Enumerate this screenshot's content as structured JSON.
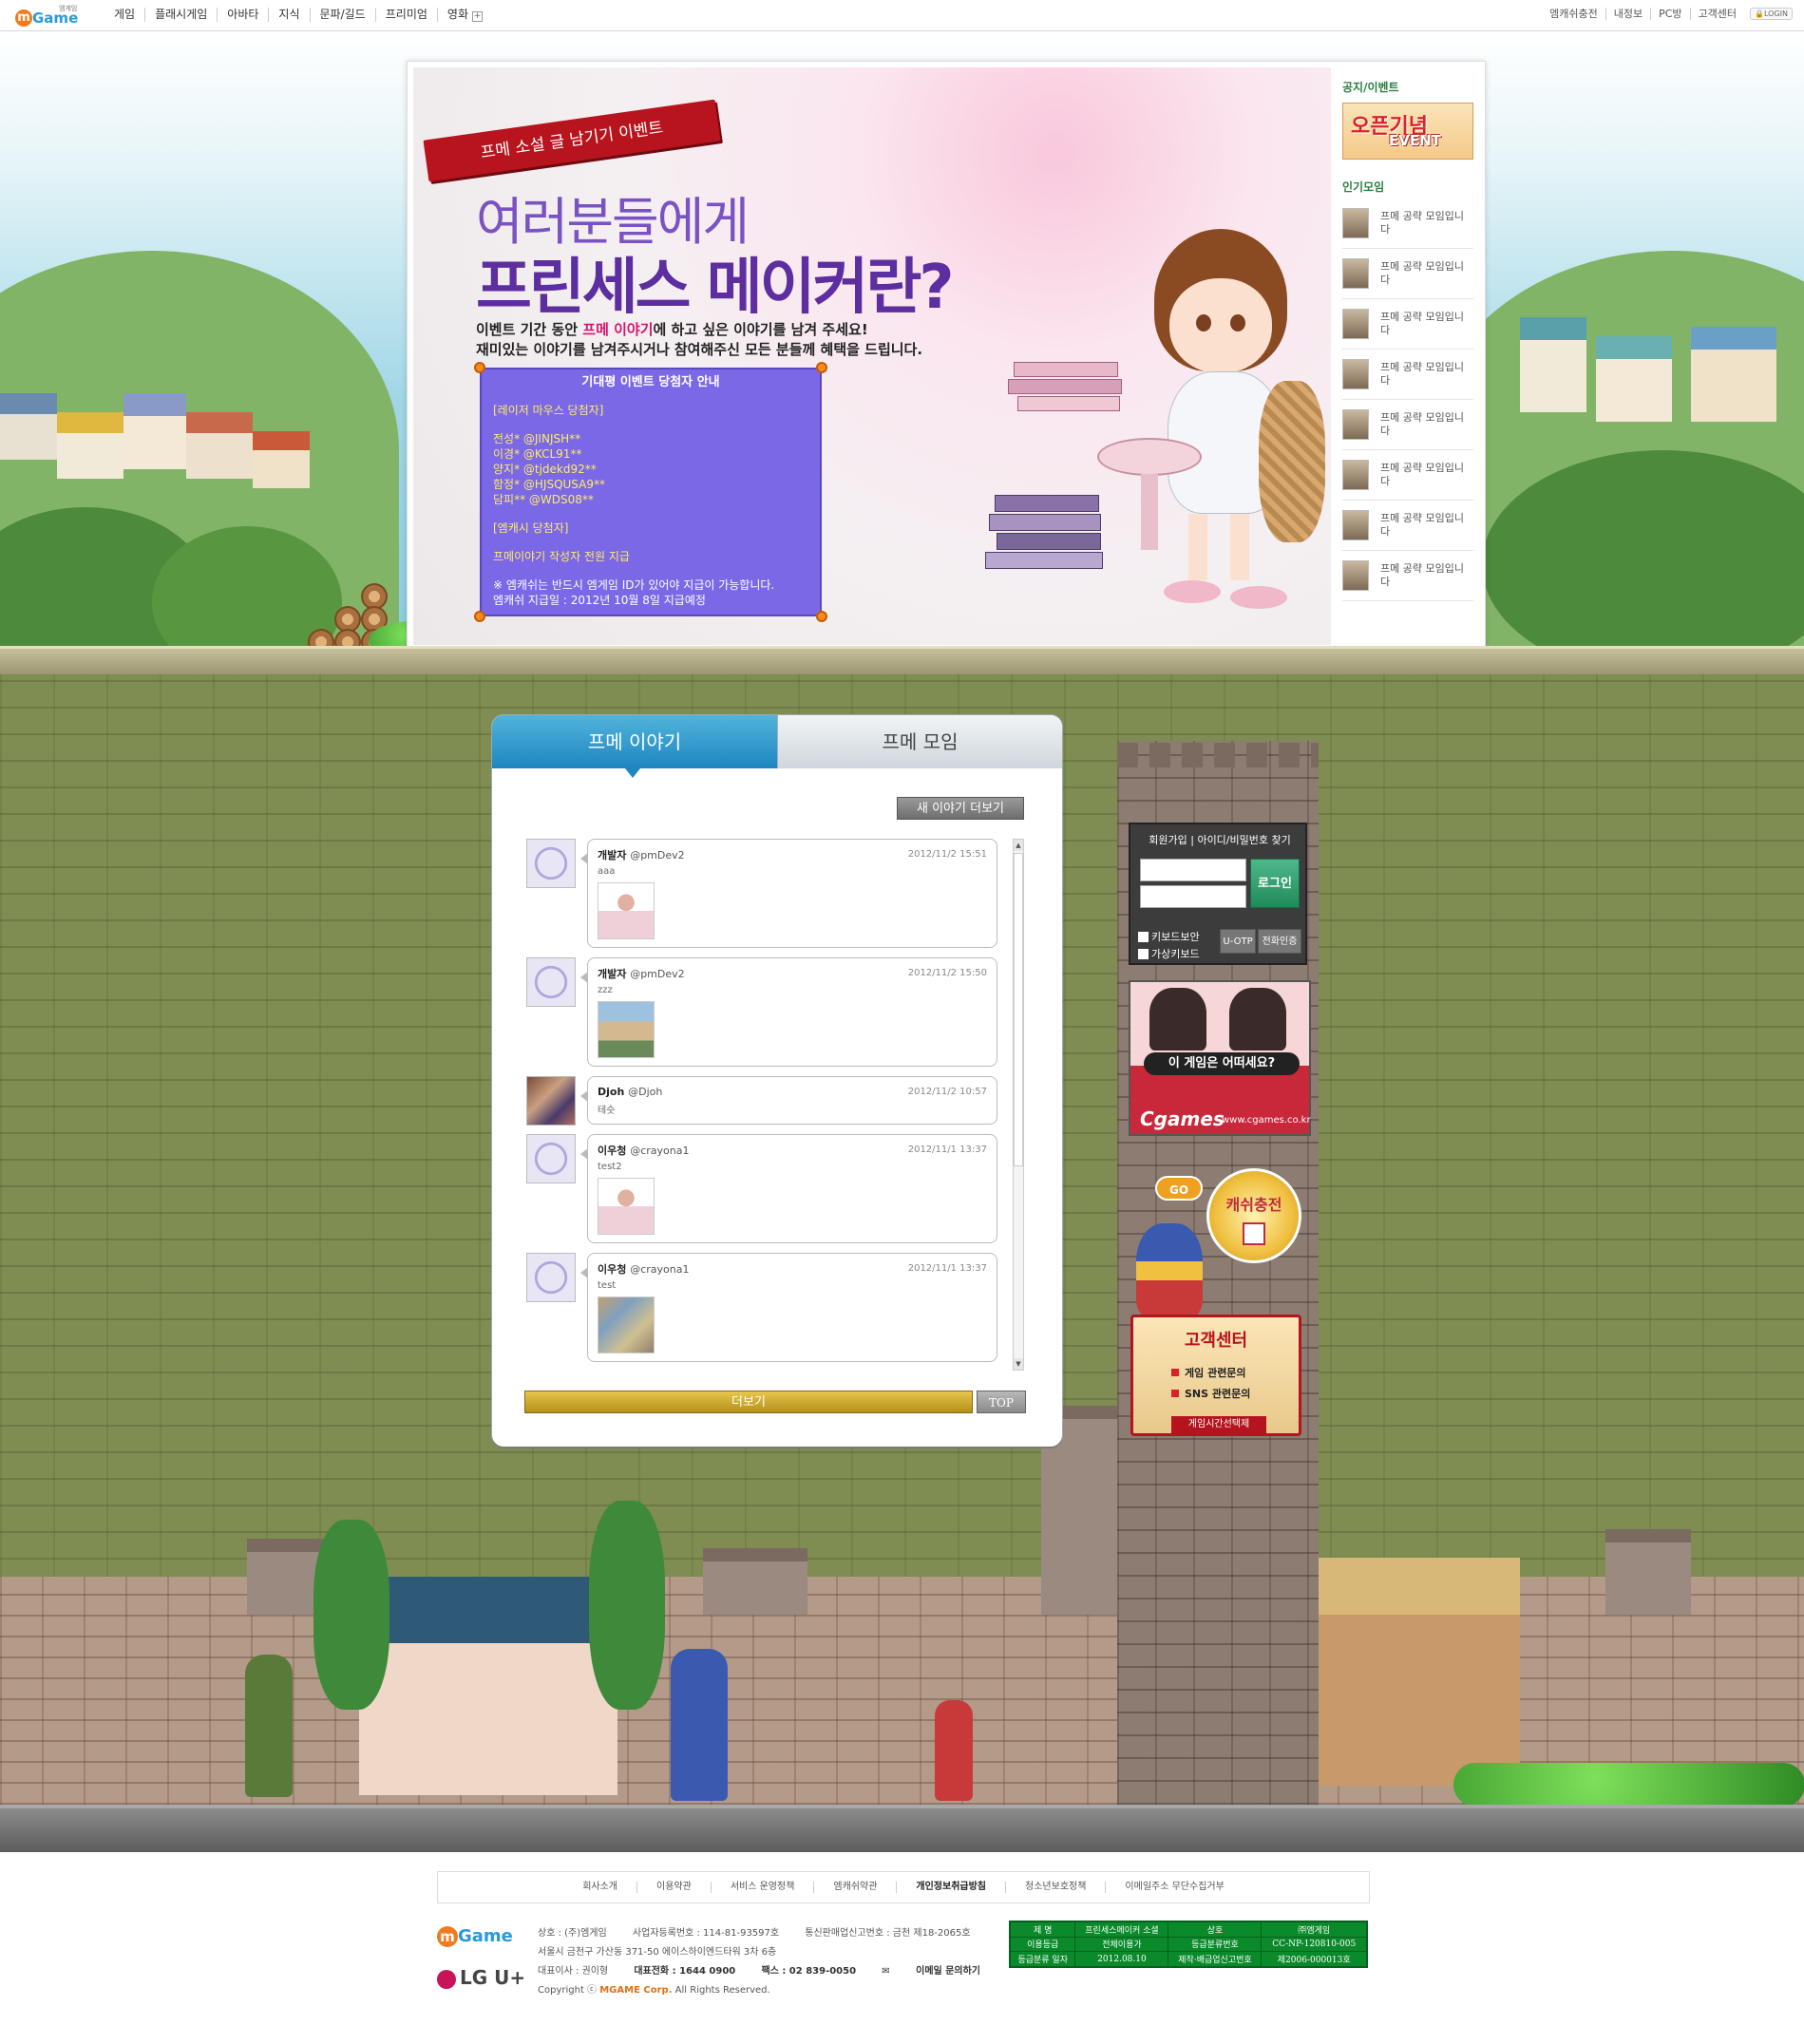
{
  "topnav": {
    "logo": {
      "m": "m",
      "rest": "Game",
      "sub": "엠게임"
    },
    "menu": [
      "게임",
      "플래시게임",
      "아바타",
      "지식",
      "문파/길드",
      "프리미엄",
      "영화"
    ],
    "menu_more": "+",
    "utils": [
      "엠캐쉬충전",
      "내정보",
      "PC방",
      "고객센터"
    ],
    "login_badge": "LOGIN"
  },
  "event": {
    "ribbon": "프메 소설 글 남기기 이벤트",
    "line1": "여러분들에게",
    "line2": "프린세스 메이커란?",
    "desc1_a": "이벤트 기간 동안 ",
    "desc1_hl": "프메 이야기",
    "desc1_b": "에 하고 싶은 이야기를 남겨 주세요!",
    "desc2": "재미있는 이야기를 남겨주시거나 참여해주신 모든 분들께 혜택을 드립니다.",
    "winners": {
      "title": "기대평 이벤트 당첨자 안내",
      "mouse_head": "[레이저 마우스 당첨자]",
      "mouse": [
        "전성* @JINJSH**",
        "이경* @KCL91**",
        "양지* @tjdekd92**",
        "함정* @HJSQUSA9**",
        "담피** @WDS08**"
      ],
      "mcash_head": "[엠캐시 당첨자]",
      "mcash": "프메이야기 작성자 전원 지급",
      "note1": "※ 엠캐쉬는 반드시 엠게임 ID가 있어야 지급이 가능합니다.",
      "note2": "엠캐쉬 지급일 : 2012년 10월 8일 지급예정"
    }
  },
  "side": {
    "notice_title": "공지/이벤트",
    "notice_img": {
      "t1": "오픈기념",
      "t2": "EVENT"
    },
    "groups_title": "인기모임",
    "groups": [
      "프메 공략 모임입니다",
      "프메 공략 모임입니다",
      "프메 공략 모임입니다",
      "프메 공략 모임입니다",
      "프메 공략 모임입니다",
      "프메 공략 모임입니다",
      "프메 공략 모임입니다",
      "프메 공략 모임입니다"
    ]
  },
  "board": {
    "tab_story": "프메 이야기",
    "tab_group": "프메 모임",
    "new_more": "새 이야기 더보기",
    "posts": [
      {
        "name": "개발자",
        "handle": "@pmDev2",
        "time": "2012/11/2 15:51",
        "text": "aaa",
        "img": "girl"
      },
      {
        "name": "개발자",
        "handle": "@pmDev2",
        "time": "2012/11/2 15:50",
        "text": "zzz",
        "img": "scene"
      },
      {
        "name": "Djoh",
        "handle": "@Djoh",
        "time": "2012/11/2 10:57",
        "text": "테슷",
        "img": ""
      },
      {
        "name": "이우청",
        "handle": "@crayona1",
        "time": "2012/11/1 13:37",
        "text": "test2",
        "img": "girl"
      },
      {
        "name": "이우청",
        "handle": "@crayona1",
        "time": "2012/11/1 13:37",
        "text": "test",
        "img": "scene2"
      }
    ],
    "more": "더보기",
    "top": "TOP"
  },
  "login": {
    "links": "회원가입 | 아이디/비밀번호 찾기",
    "button": "로그인",
    "chk1": "키보드보안",
    "chk2": "가상키보드",
    "otp": "U-OTP",
    "phone": "전화인증"
  },
  "cgames": {
    "question": "이 게임은 어떠세요?",
    "logo": "Cgames",
    "url": "www.cgames.co.kr"
  },
  "cash": {
    "go": "GO",
    "label": "캐쉬충전"
  },
  "cs": {
    "title": "고객센터",
    "l1": "게임 관련문의",
    "l2": "SNS 관련문의",
    "btn": "게임시간선택제"
  },
  "footer": {
    "links": [
      "회사소개",
      "이용약관",
      "서비스 운영정책",
      "엠캐쉬약관",
      "개인정보취급방침",
      "청소년보호정책",
      "이메일주소 무단수집거부"
    ],
    "bold_index": 4,
    "logo": {
      "m": "m",
      "rest": "Game"
    },
    "lgu": "LG U+",
    "info1": [
      "상호 : (주)엠게임",
      "사업자등록번호 : 114-81-93597호",
      "통신판매업신고번호 : 금천 제18-2065호"
    ],
    "info2": "서울시 금천구 가산동 371-50 에이스하이엔드타워 3차 6층",
    "info3": [
      "대표이사 : 권이형",
      "대표전화 : 1644 0900",
      "팩스 : 02 839-0050",
      "이메일 문의하기"
    ],
    "copy_a": "Copyright ⓒ ",
    "copy_b": "MGAME Corp.",
    "copy_c": " All Rights Reserved.",
    "rating": [
      [
        "제 명",
        "프린세스메이커 소셜",
        "상호",
        "㈜엠게임"
      ],
      [
        "이용등급",
        "전체이용가",
        "등급분류번호",
        "CC-NP-120810-005"
      ],
      [
        "등급분류 일자",
        "2012.08.10",
        "제작·배급업신고번호",
        "제2006-000013호"
      ]
    ]
  }
}
